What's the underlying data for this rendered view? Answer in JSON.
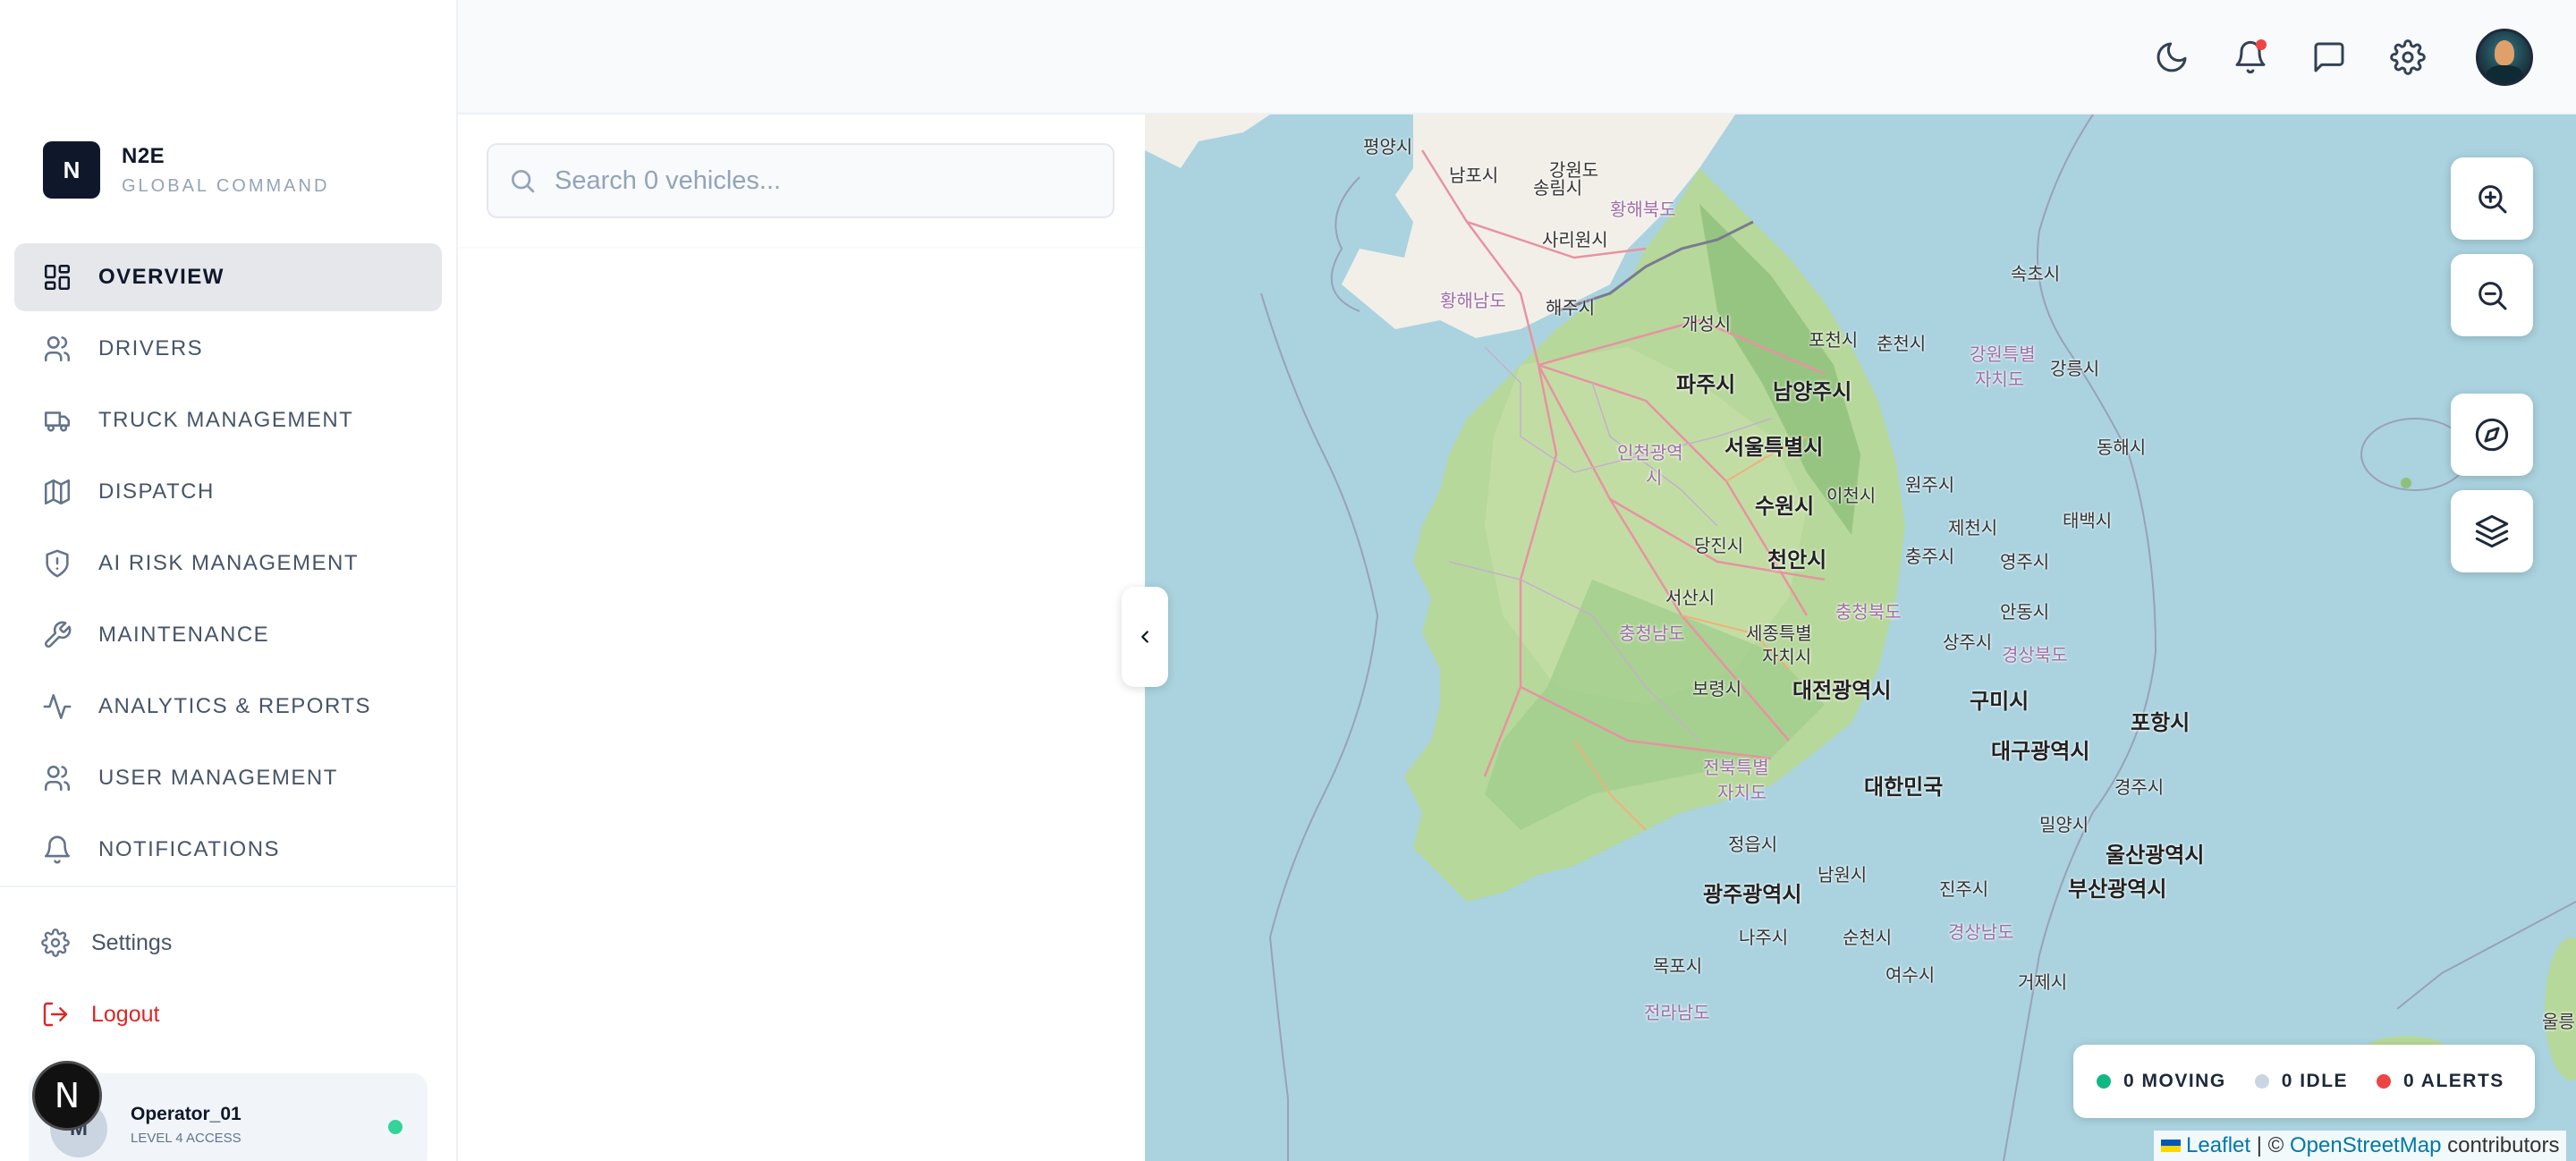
{
  "brand": {
    "logo_letter": "N",
    "name": "N2E",
    "subtitle": "GLOBAL COMMAND"
  },
  "sidebar": {
    "items": [
      {
        "label": "OVERVIEW",
        "icon": "dashboard-grid-icon",
        "active": true
      },
      {
        "label": "DRIVERS",
        "icon": "users-icon",
        "active": false
      },
      {
        "label": "TRUCK MANAGEMENT",
        "icon": "truck-icon",
        "active": false
      },
      {
        "label": "DISPATCH",
        "icon": "map-icon",
        "active": false
      },
      {
        "label": "AI RISK MANAGEMENT",
        "icon": "shield-alert-icon",
        "active": false
      },
      {
        "label": "MAINTENANCE",
        "icon": "wrench-icon",
        "active": false
      },
      {
        "label": "ANALYTICS & REPORTS",
        "icon": "activity-icon",
        "active": false
      },
      {
        "label": "USER MANAGEMENT",
        "icon": "users-icon",
        "active": false
      },
      {
        "label": "NOTIFICATIONS",
        "icon": "bell-icon",
        "active": false
      }
    ],
    "settings_label": "Settings",
    "logout_label": "Logout"
  },
  "user": {
    "initial": "M",
    "name": "Operator_01",
    "role": "LEVEL 4 ACCESS",
    "status": "online"
  },
  "n_badge": "N",
  "header": {
    "icons": [
      "moon-icon",
      "bell-icon",
      "message-square-icon",
      "gear-icon",
      "profile-avatar"
    ],
    "has_notification": true
  },
  "vehicles": {
    "search_placeholder": "Search 0 vehicles...",
    "search_value": ""
  },
  "map": {
    "labels": [
      "평양시",
      "강원도",
      "남포시",
      "송림시",
      "황해북도",
      "사리원시",
      "황해남도",
      "해주시",
      "개성시",
      "속초시",
      "포천시",
      "춘천시",
      "강원특별",
      "자치도",
      "강릉시",
      "파주시",
      "남양주시",
      "서울특별시",
      "인천광역",
      "시",
      "동해시",
      "수원시",
      "이천시",
      "원주시",
      "제천시",
      "태백시",
      "당진시",
      "천안시",
      "충주시",
      "영주시",
      "서산시",
      "충청북도",
      "안동시",
      "충청남도",
      "세종특별",
      "자치시",
      "상주시",
      "경상북도",
      "보령시",
      "대전광역시",
      "구미시",
      "포항시",
      "대구광역시",
      "전북특별",
      "자치도",
      "대한민국",
      "경주시",
      "밀양시",
      "울산광역시",
      "정읍시",
      "남원시",
      "진주시",
      "부산광역시",
      "광주광역시",
      "나주시",
      "순천시",
      "경상남도",
      "여수시",
      "거제시",
      "목포시",
      "전라남도",
      "울릉"
    ],
    "controls": [
      "zoom-in-icon",
      "zoom-out-icon",
      "compass-icon",
      "layers-icon"
    ]
  },
  "legend": [
    {
      "label": "0 MOVING",
      "color": "#10b981"
    },
    {
      "label": "0 IDLE",
      "color": "#cbd5e1"
    },
    {
      "label": "0 ALERTS",
      "color": "#ef4444"
    }
  ],
  "attribution": {
    "leaflet": "Leaflet",
    "separator": " | © ",
    "osm": "OpenStreetMap",
    "suffix": " contributors"
  },
  "colors": {
    "accent": "#0f172a",
    "logout": "#dc2626",
    "sea": "#aad3df",
    "land": "#9fcf88"
  }
}
